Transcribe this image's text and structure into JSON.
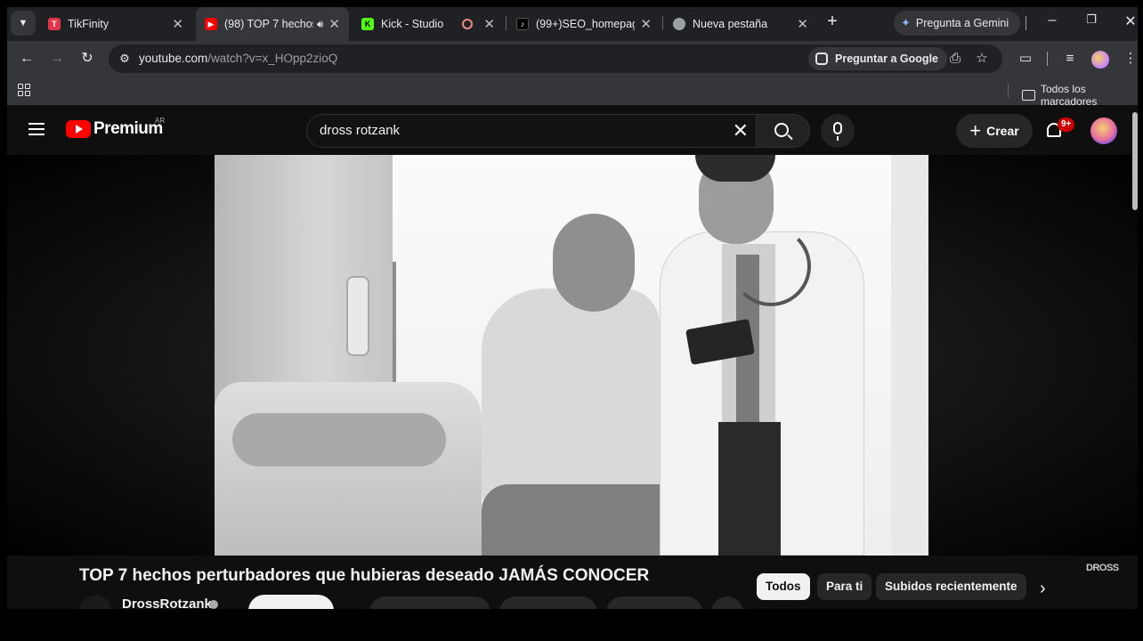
{
  "browser": {
    "tabs": [
      {
        "label": "TikFinity",
        "favicon": "tikfinity-icon",
        "color": "#e2364b",
        "active": false
      },
      {
        "label": "(98) TOP 7 hechos",
        "favicon": "youtube-icon",
        "color": "#ff0000",
        "active": true,
        "audio": true
      },
      {
        "label": "Kick - Studio",
        "favicon": "kick-icon",
        "color": "#53fc18",
        "active": false,
        "recording": true
      },
      {
        "label": "(99+)SEO_homepage",
        "favicon": "tiktok-icon",
        "color": "#000000",
        "active": false
      },
      {
        "label": "Nueva pestaña",
        "favicon": "chrome-icon",
        "color": "#9aa0a6",
        "active": false
      }
    ],
    "gemini_label": "Pregunta a Gemini",
    "url_host": "youtube.com",
    "url_path": "/watch?v=x_HOpp2zioQ",
    "ask_google_label": "Preguntar a Google",
    "bookmarks_label": "Todos los marcadores"
  },
  "youtube": {
    "logo_text": "Premium",
    "country_code": "AR",
    "search_query": "dross rotzank",
    "create_label": "Crear",
    "notification_count": "9+",
    "video_title": "TOP 7 hechos perturbadores que hubieras deseado JAMÁS CONOCER",
    "channel_name": "DrossRotzank",
    "watermark": "DROSS",
    "chips": [
      "Todos",
      "Para ti",
      "Subidos recientemente"
    ],
    "selected_chip": "Todos"
  }
}
